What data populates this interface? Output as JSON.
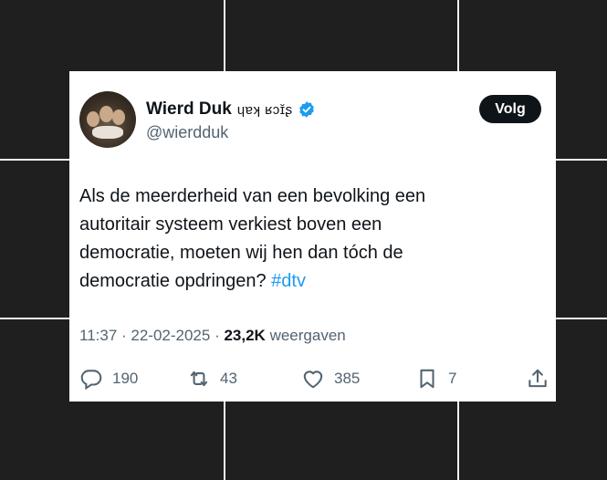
{
  "tweet": {
    "display_name": "Wierd Duk",
    "name_suffix": "ɥɐʞ ʁɔɪ̆ʂ",
    "handle": "@wierdduk",
    "follow_label": "Volg",
    "text_parts": {
      "line1": "Als de meerderheid van een bevolking een",
      "line2": "autoritair systeem verkiest boven een",
      "line3": "democratie, moeten wij hen dan tóch de",
      "line4": "democratie opdringen? ",
      "hashtag": "#dtv"
    },
    "time": "11:37 · 22-02-2025 · ",
    "views_count": "23,2K",
    "views_label": " weergaven"
  },
  "actions": {
    "replies": "190",
    "retweets": "43",
    "likes": "385",
    "bookmarks": "7"
  },
  "icons": {
    "verified": "verified-badge-icon",
    "reply": "reply-icon",
    "retweet": "retweet-icon",
    "like": "heart-icon",
    "bookmark": "bookmark-icon",
    "share": "share-icon"
  },
  "colors": {
    "background": "#1f1f1f",
    "card": "#ffffff",
    "text": "#0f1419",
    "muted": "#536471",
    "link": "#1d9bf0",
    "follow_button": "#0f1419"
  }
}
